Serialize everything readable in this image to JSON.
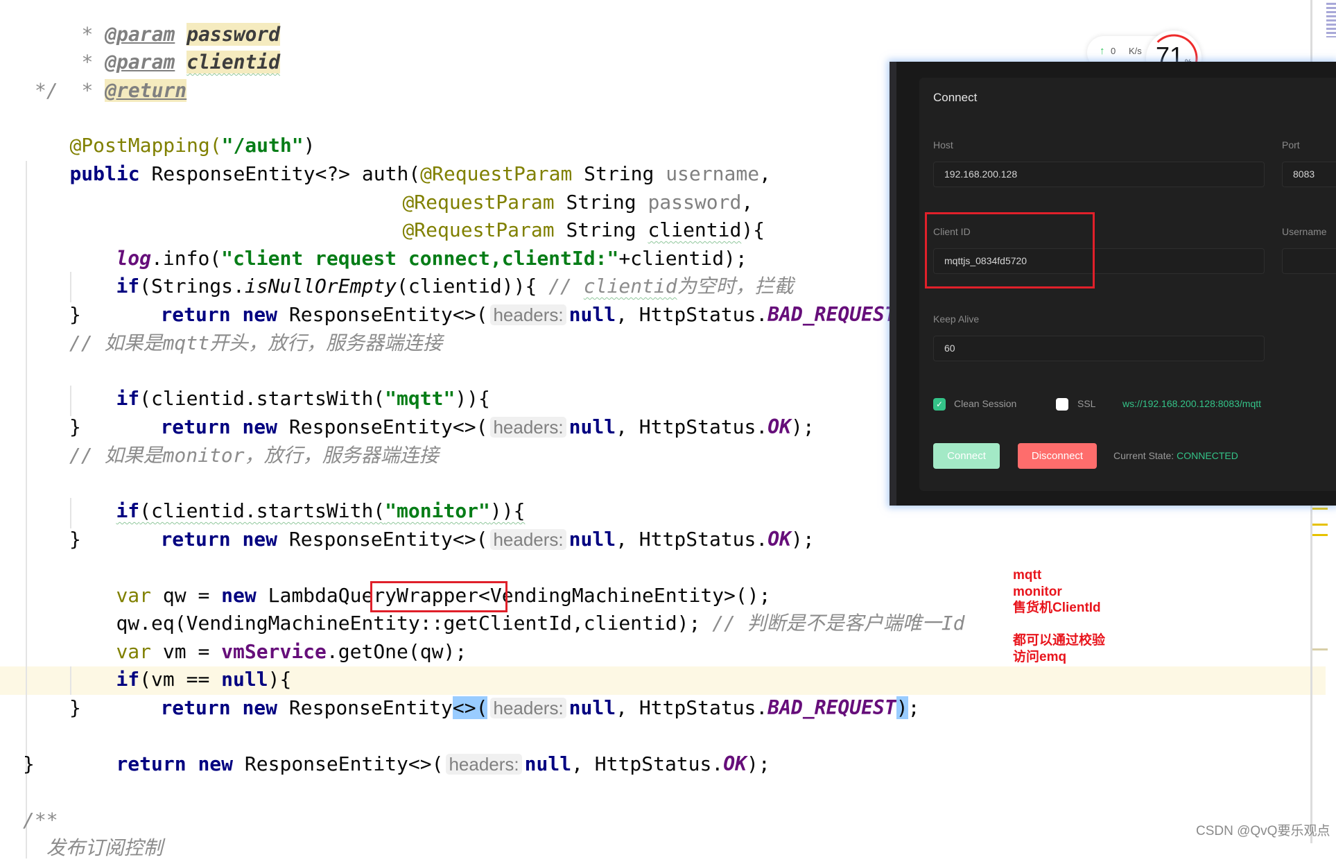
{
  "editor": {
    "doc_lines": [
      {
        "star": "* ",
        "tag": "@param",
        "param": "password"
      },
      {
        "star": "* ",
        "tag": "@param",
        "param": "clientid"
      },
      {
        "star": "* ",
        "tag": "@return"
      }
    ],
    "doc_end": "*/",
    "annotation_line": {
      "ann": "@PostMapping(",
      "str": "\"/auth\"",
      "close": ")"
    },
    "signature": {
      "kw": "public",
      "rest": " ResponseEntity<?> auth(",
      "param_ann": "@RequestParam",
      "param_type": " String ",
      "p1": "username",
      "p2": "password",
      "p3": "clientid",
      "comma": ",",
      "open": "){"
    },
    "log_line": {
      "field": "log",
      "call": ".info(",
      "str": "\"client request connect,clientId:\"",
      "rest": "+clientid);"
    },
    "if_null": {
      "kw": "if",
      "pre": "(Strings.",
      "method": "isNullOrEmpty",
      "post": "(clientid)){ ",
      "comment_a": "// ",
      "comment_b": "clientid",
      "comment_c": "为空时，拦截"
    },
    "return_kw": "return",
    "new_kw": "new",
    "response_entity": " ResponseEntity<>(",
    "hint_headers": "headers:",
    "null_kw": "null",
    "http_status": ", HttpStatus.",
    "bad_request": "BAD_REQUEST",
    "ok": "OK",
    "end_call": ");",
    "close_brace": "}",
    "comment_mqtt": "// 如果是mqtt开头，放行，服务器端连接",
    "if_mqtt": {
      "kw": "if",
      "pre": "(clientid.startsWith(",
      "str": "\"mqtt\"",
      "post": ")){"
    },
    "comment_monitor": "// 如果是monitor，放行，服务器端连接",
    "if_monitor": {
      "kw": "if",
      "pre": "(clientid.startsWith(",
      "str": "\"monitor\"",
      "post": ")){"
    },
    "var_qw": {
      "var": "var",
      "a": " qw = ",
      "kw": "new",
      "b": " LambdaQueryWrapper<VendingMachineEntity>();"
    },
    "qw_eq": {
      "a": "qw.eq(VendingMachineEntity:",
      "boxed": ":getClientId,",
      "b": "clientid); ",
      "comment": "// 判断是不是客户端唯一Id"
    },
    "var_vm": {
      "var": "var",
      "a": " vm = ",
      "inst": "vmService",
      "b": ".getOne(qw);"
    },
    "if_vm": {
      "kw": "if",
      "a": "(vm == ",
      "null": "null",
      "b": "){"
    },
    "rt_pre": " ResponseEntity",
    "rt_diamond": "<>(",
    "rt_close": ")",
    "rt_semi": ";",
    "javadoc_open": "/**",
    "javadoc_next": "  发布订阅控制"
  },
  "net_widget": {
    "arrow": "↑",
    "value": "0",
    "unit": "K/s"
  },
  "gauge": {
    "value": "71",
    "unit": "%",
    "percent": 71
  },
  "mqtt_dialog": {
    "title": "Connect",
    "host_label": "Host",
    "host_value": "192.168.200.128",
    "port_label": "Port",
    "port_value": "8083",
    "client_id_label": "Client ID",
    "client_id_value": "mqttjs_0834fd5720",
    "username_label": "Username",
    "username_value": "",
    "keep_alive_label": "Keep Alive",
    "keep_alive_value": "60",
    "clean_session_label": "Clean Session",
    "clean_session_checked": true,
    "ssl_label": "SSL",
    "ssl_checked": false,
    "url": "ws://192.168.200.128:8083/mqtt",
    "connect_label": "Connect",
    "disconnect_label": "Disconnect",
    "state_label": "Current State:",
    "state_value": "CONNECTED",
    "colors": {
      "accent_green": "#34c388",
      "disconnect_red": "#fe6d6c",
      "connect_green_disabled": "#a3e9c6"
    }
  },
  "annotation_note": {
    "lines": [
      "mqtt",
      "monitor",
      "售货机ClientId",
      "",
      "都可以通过校验",
      "访问emq"
    ],
    "color": "#e8141c"
  },
  "watermark": "CSDN @QvQ要乐观点"
}
